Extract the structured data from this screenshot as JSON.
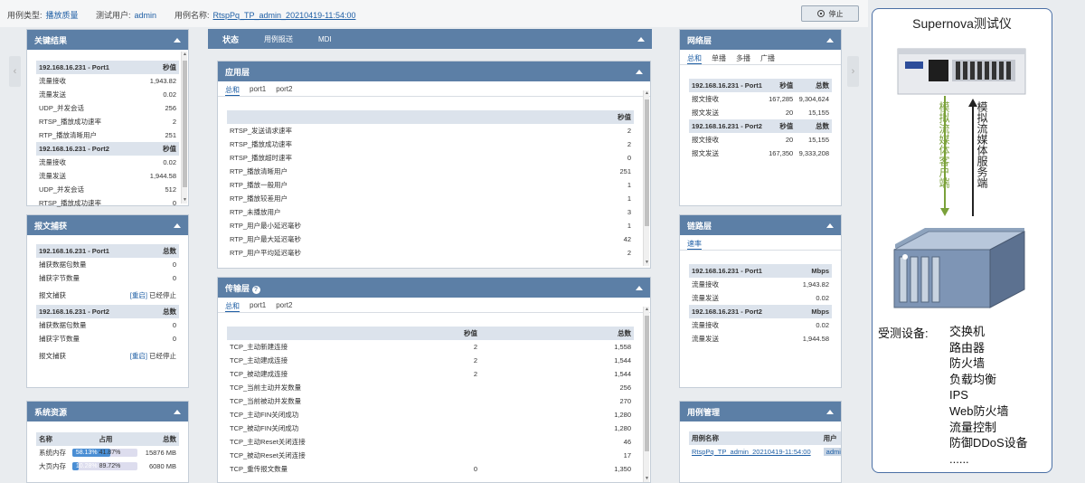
{
  "topbar": {
    "case_type_label": "用例类型:",
    "case_type_value": "播放质量",
    "test_user_label": "测试用户:",
    "test_user_value": "admin",
    "case_name_label": "用例名称:",
    "case_name_value": "RtspPq_TP_admin_20210419-11:54:00",
    "stop_label": "停止"
  },
  "key_results": {
    "title": "关键结果",
    "header_col": "秒值",
    "groups": [
      {
        "name": "192.168.16.231 - Port1",
        "rows": [
          [
            "流量接收",
            "1,943.82"
          ],
          [
            "流量发送",
            "0.02"
          ],
          [
            "UDP_并发会话",
            "256"
          ],
          [
            "RTSP_播放成功速率",
            "2"
          ],
          [
            "RTP_播放清晰用户",
            "251"
          ]
        ]
      },
      {
        "name": "192.168.16.231 - Port2",
        "rows": [
          [
            "流量接收",
            "0.02"
          ],
          [
            "流量发送",
            "1,944.58"
          ],
          [
            "UDP_并发会话",
            "512"
          ],
          [
            "RTSP_播放成功速率",
            "0"
          ]
        ]
      }
    ]
  },
  "capture": {
    "title": "报文捕获",
    "header_col": "总数",
    "groups": [
      {
        "name": "192.168.16.231 - Port1",
        "rows": [
          [
            "捕获数据包数量",
            "0"
          ],
          [
            "捕获字节数量",
            "0"
          ]
        ],
        "cap_label": "报文捕获",
        "restart": "[重启]",
        "status": "已经停止"
      },
      {
        "name": "192.168.16.231 - Port2",
        "rows": [
          [
            "捕获数据包数量",
            "0"
          ],
          [
            "捕获字节数量",
            "0"
          ]
        ],
        "cap_label": "报文捕获",
        "restart": "[重启]",
        "status": "已经停止"
      }
    ]
  },
  "sysres": {
    "title": "系统资源",
    "headers": [
      "名称",
      "占用",
      "总数"
    ],
    "rows": [
      {
        "name": "系统内存",
        "used": "58.13%",
        "free": "41.87%",
        "used_frac": 0.5813,
        "total": "15876 MB"
      },
      {
        "name": "大页内存",
        "used": "10.28%",
        "free": "89.72%",
        "used_frac": 0.1028,
        "total": "6080 MB"
      }
    ]
  },
  "center_tabs": [
    "状态",
    "用例报送",
    "MDI"
  ],
  "app_layer": {
    "title": "应用层",
    "tabs": [
      "总和",
      "port1",
      "port2"
    ],
    "header_col": "秒值",
    "rows": [
      [
        "RTSP_发送请求速率",
        "2"
      ],
      [
        "RTSP_播放成功速率",
        "2"
      ],
      [
        "RTSP_播放超时速率",
        "0"
      ],
      [
        "RTP_播放清晰用户",
        "251"
      ],
      [
        "RTP_播放一般用户",
        "1"
      ],
      [
        "RTP_播放较差用户",
        "1"
      ],
      [
        "RTP_未播放用户",
        "3"
      ],
      [
        "RTP_用户最小延迟毫秒",
        "1"
      ],
      [
        "RTP_用户最大延迟毫秒",
        "42"
      ],
      [
        "RTP_用户平均延迟毫秒",
        "2"
      ]
    ]
  },
  "transport_layer": {
    "title": "传输层",
    "tabs": [
      "总和",
      "port1",
      "port2"
    ],
    "headers": [
      "",
      "秒值",
      "总数"
    ],
    "rows": [
      [
        "TCP_主动新建连接",
        "2",
        "1,558"
      ],
      [
        "TCP_主动建成连接",
        "2",
        "1,544"
      ],
      [
        "TCP_被动建成连接",
        "2",
        "1,544"
      ],
      [
        "TCP_当前主动并发数量",
        "",
        "256"
      ],
      [
        "TCP_当前被动并发数量",
        "",
        "270"
      ],
      [
        "TCP_主动FIN关闭成功",
        "",
        "1,280"
      ],
      [
        "TCP_被动FIN关闭成功",
        "",
        "1,280"
      ],
      [
        "TCP_主动Reset关闭连接",
        "",
        "46"
      ],
      [
        "TCP_被动Reset关闭连接",
        "",
        "17"
      ],
      [
        "TCP_重传报文数量",
        "0",
        "1,350"
      ]
    ]
  },
  "net_layer": {
    "title": "网络层",
    "tabs": [
      "总和",
      "单播",
      "多播",
      "广播"
    ],
    "headers": [
      "秒值",
      "总数"
    ],
    "groups": [
      {
        "name": "192.168.16.231 - Port1",
        "rows": [
          [
            "报文接收",
            "167,285",
            "9,304,624"
          ],
          [
            "报文发送",
            "20",
            "15,155"
          ]
        ]
      },
      {
        "name": "192.168.16.231 - Port2",
        "rows": [
          [
            "报文接收",
            "20",
            "15,155"
          ],
          [
            "报文发送",
            "167,350",
            "9,333,208"
          ]
        ]
      }
    ]
  },
  "link_layer": {
    "title": "链路层",
    "tabs": [
      "速率"
    ],
    "header_col": "Mbps",
    "groups": [
      {
        "name": "192.168.16.231 - Port1",
        "rows": [
          [
            "流量接收",
            "1,943.82"
          ],
          [
            "流量发送",
            "0.02"
          ]
        ]
      },
      {
        "name": "192.168.16.231 - Port2",
        "rows": [
          [
            "流量接收",
            "0.02"
          ],
          [
            "流量发送",
            "1,944.58"
          ]
        ]
      }
    ]
  },
  "case_mgmt": {
    "title": "用例管理",
    "headers": [
      "用例名称",
      "用户"
    ],
    "row": [
      "RtspPq_TP_admin_20210419-11:54:00",
      "admin"
    ]
  },
  "diagram": {
    "title": "Supernova测试仪",
    "client_label": "模拟流媒体客户端",
    "server_label": "模拟流媒体服务端",
    "dut_label": "受测设备:",
    "dut_items": [
      "交换机",
      "路由器",
      "防火墙",
      "负载均衡",
      "IPS",
      "Web防火墙",
      "流量控制",
      "防御DDoS设备",
      "......"
    ]
  },
  "colors": {
    "header": "#5c7fa6",
    "accent": "#1f5fa5",
    "client_arrow": "#7aa13a",
    "server_arrow": "#222222"
  }
}
